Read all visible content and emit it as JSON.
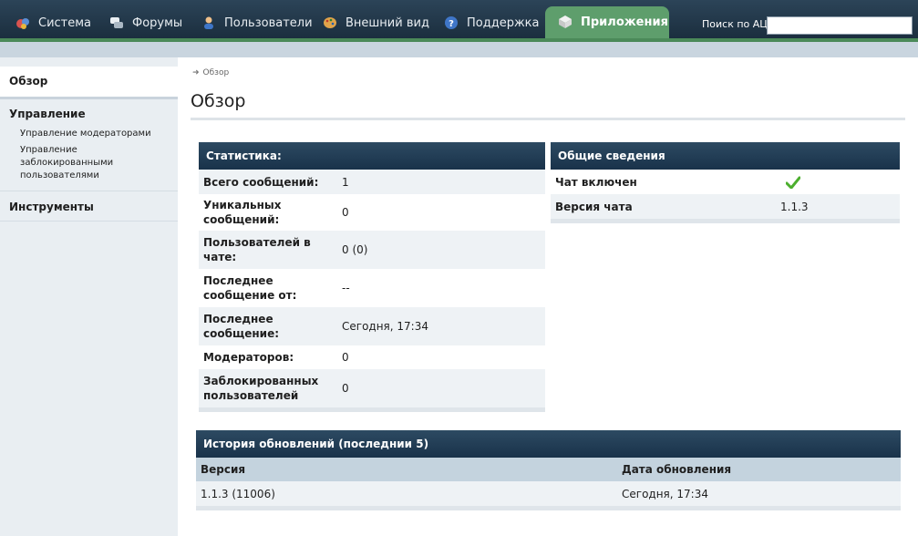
{
  "nav": {
    "tabs": [
      {
        "label": "Система",
        "icon": "system-icon"
      },
      {
        "label": "Форумы",
        "icon": "forums-icon"
      },
      {
        "label": "Пользователи",
        "icon": "users-icon"
      },
      {
        "label": "Внешний вид",
        "icon": "palette-icon"
      },
      {
        "label": "Поддержка",
        "icon": "help-icon"
      },
      {
        "label": "Приложения",
        "icon": "apps-icon"
      }
    ],
    "active_tab": "Приложения",
    "search_label": "Поиск по АЦ:",
    "search_value": ""
  },
  "sidebar": {
    "overview": "Обзор",
    "manage_heading": "Управление",
    "manage_links": [
      "Управление модераторами",
      "Управление заблокированными пользователями"
    ],
    "tools_heading": "Инструменты"
  },
  "breadcrumb": "Обзор",
  "page_title": "Обзор",
  "stats": {
    "title": "Статистика:",
    "rows": [
      {
        "label": "Всего сообщений:",
        "value": "1"
      },
      {
        "label": "Уникальных сообщений:",
        "value": "0"
      },
      {
        "label": "Пользователей в чате:",
        "value": "0 (0)"
      },
      {
        "label": "Последнее сообщение от:",
        "value": "--"
      },
      {
        "label": "Последнее сообщение:",
        "value": "Сегодня, 17:34"
      },
      {
        "label": "Модераторов:",
        "value": "0"
      },
      {
        "label": "Заблокированных пользователей",
        "value": "0"
      }
    ]
  },
  "general": {
    "title": "Общие сведения",
    "rows": [
      {
        "label": "Чат включен",
        "value": ""
      },
      {
        "label": "Версия чата",
        "value": "1.1.3"
      }
    ],
    "check_color": "#4caf2e"
  },
  "history": {
    "title": "История обновлений (последнии 5)",
    "columns": [
      "Версия",
      "Дата обновления"
    ],
    "rows": [
      {
        "version": "1.1.3 (11006)",
        "date": "Сегодня, 17:34"
      }
    ]
  }
}
